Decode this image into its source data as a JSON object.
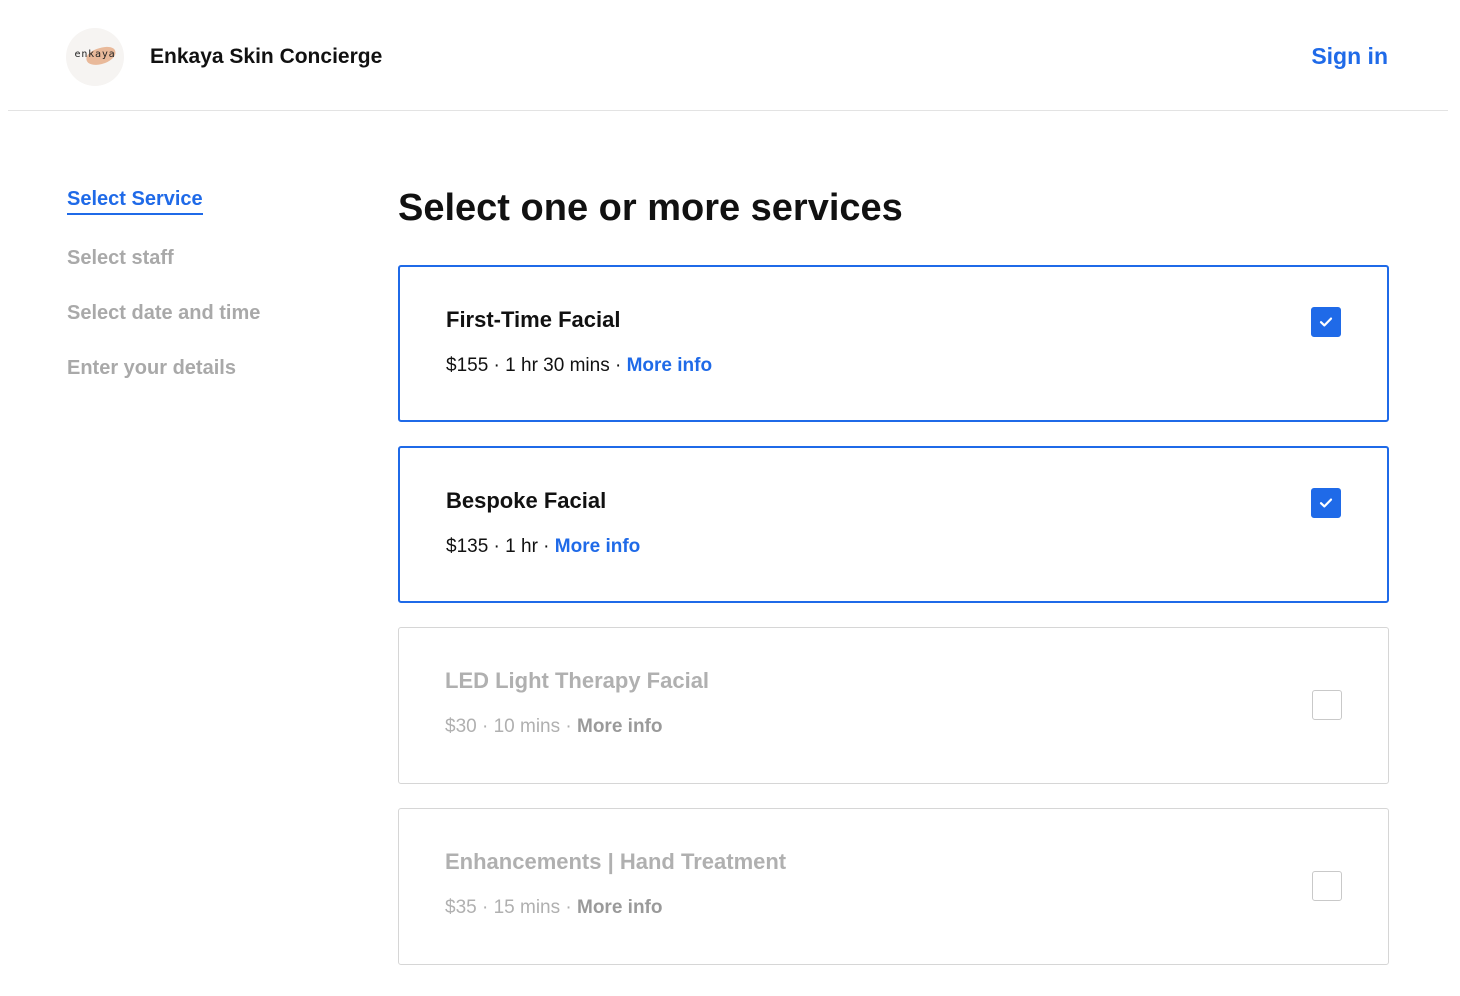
{
  "header": {
    "logo_text": "enkaya",
    "business_name": "Enkaya Skin Concierge",
    "sign_in_label": "Sign in"
  },
  "steps": [
    {
      "label": "Select Service",
      "active": true
    },
    {
      "label": "Select staff",
      "active": false
    },
    {
      "label": "Select date and time",
      "active": false
    },
    {
      "label": "Enter your details",
      "active": false
    }
  ],
  "main": {
    "heading": "Select one or more services",
    "services": [
      {
        "name": "First-Time Facial",
        "meta": "$155 · 1 hr 30 mins · ",
        "more_info": "More info",
        "checked": true,
        "disabled": false
      },
      {
        "name": "Bespoke Facial",
        "meta": "$135 · 1 hr · ",
        "more_info": "More info",
        "checked": true,
        "disabled": false
      },
      {
        "name": "LED Light Therapy Facial",
        "meta": "$30 · 10 mins · ",
        "more_info": "More info",
        "checked": false,
        "disabled": true
      },
      {
        "name": "Enhancements | Hand Treatment",
        "meta": "$35 · 15 mins · ",
        "more_info": "More info",
        "checked": false,
        "disabled": true
      }
    ]
  },
  "colors": {
    "accent": "#1f6ae8",
    "muted_text": "#a9a9a9",
    "border": "#d6d6d6"
  },
  "icons": {
    "checkbox_checked": "check-icon"
  }
}
